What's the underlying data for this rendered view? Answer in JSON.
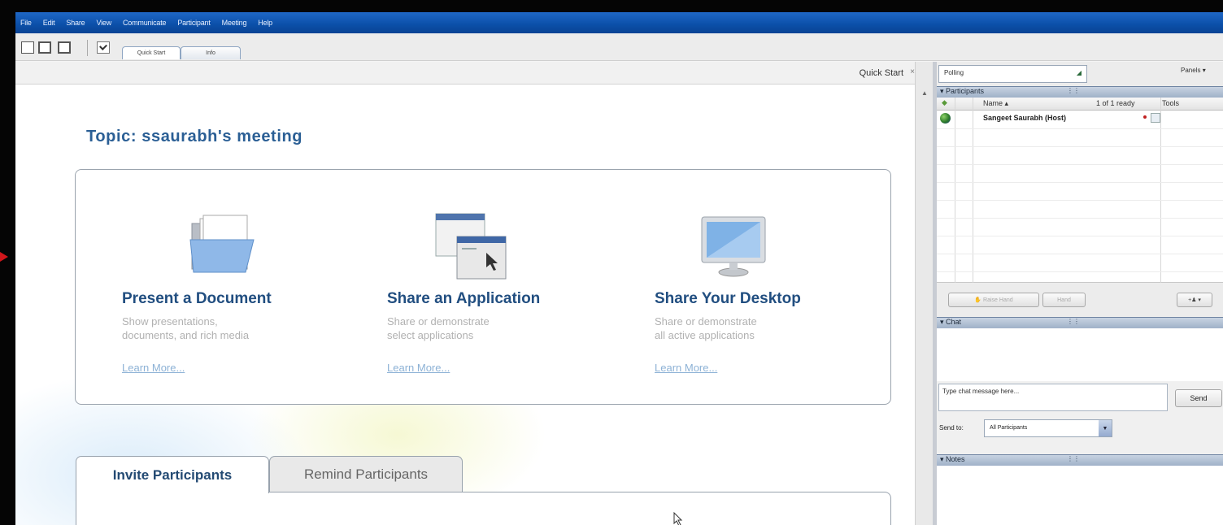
{
  "menu": [
    "File",
    "Edit",
    "Share",
    "View",
    "Communicate",
    "Participant",
    "Meeting",
    "Help"
  ],
  "toolbar": {
    "tabs": [
      "Quick Start",
      "Info"
    ]
  },
  "quick_start": {
    "label": "Quick Start",
    "close": "×"
  },
  "topic": "Topic: ssaurabh's meeting",
  "features": [
    {
      "title": "Present a Document",
      "desc_line1": "Show presentations,",
      "desc_line2": "documents, and rich media",
      "link": "Learn More..."
    },
    {
      "title": "Share an Application",
      "desc_line1": "Share or demonstrate",
      "desc_line2": "select applications",
      "link": "Learn More..."
    },
    {
      "title": "Share Your Desktop",
      "desc_line1": "Share or demonstrate",
      "desc_line2": "all active applications",
      "link": "Learn More..."
    }
  ],
  "bottom_tabs": [
    "Invite Participants",
    "Remind Participants"
  ],
  "right": {
    "polling": "Polling",
    "panels": "Panels",
    "participants": {
      "header": "Participants",
      "col_name": "Name",
      "col_ready": "1 of 1 ready",
      "col_tools": "Tools",
      "rows": [
        {
          "name": "Sangeet Saurabh (Host)"
        }
      ],
      "btn_raise": "Raise Hand",
      "btn_lower": "Hand"
    },
    "chat": {
      "header": "Chat",
      "placeholder": "Type chat message here...",
      "send": "Send",
      "send_to_label": "Send to:",
      "send_to_value": "All Participants"
    },
    "notes": {
      "header": "Notes"
    }
  }
}
